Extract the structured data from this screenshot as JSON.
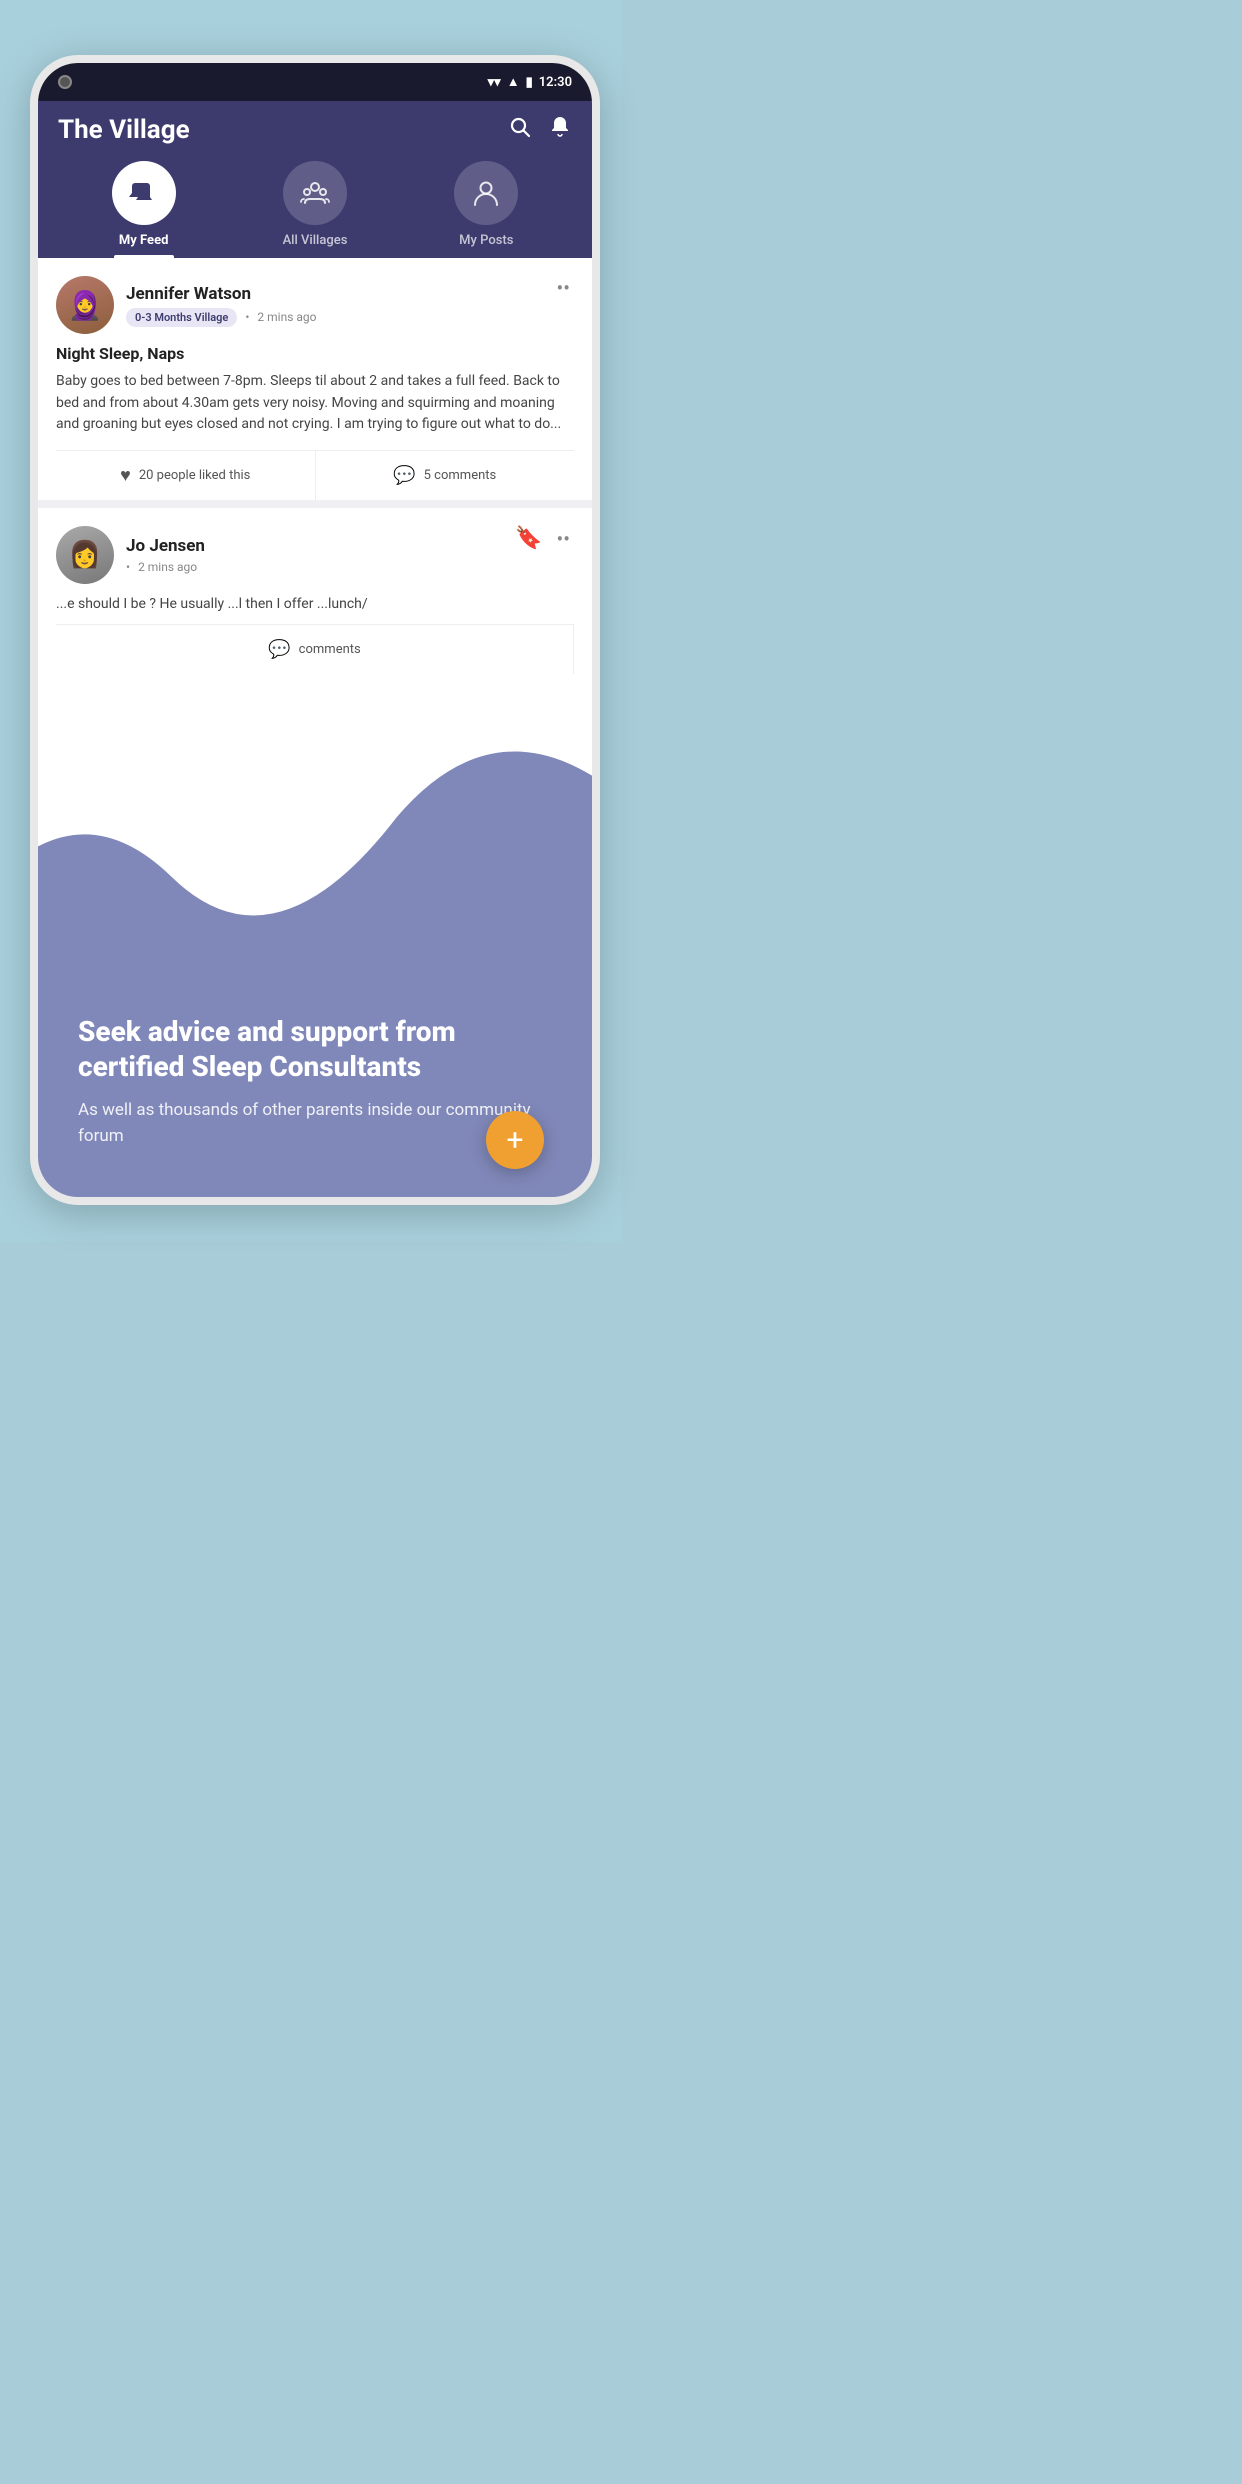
{
  "background_color": "#a8cdd9",
  "status_bar": {
    "time": "12:30",
    "icons": [
      "wifi",
      "signal",
      "battery"
    ]
  },
  "app": {
    "title": "The Village",
    "search_label": "Search",
    "notification_label": "Notifications"
  },
  "tabs": [
    {
      "id": "my-feed",
      "label": "My Feed",
      "active": true,
      "icon": "chat-bubble"
    },
    {
      "id": "all-villages",
      "label": "All Villages",
      "active": false,
      "icon": "group"
    },
    {
      "id": "my-posts",
      "label": "My Posts",
      "active": false,
      "icon": "person"
    }
  ],
  "posts": [
    {
      "id": 1,
      "author": "Jennifer Watson",
      "village_tag": "0-3 Months Village",
      "time": "2 mins ago",
      "title": "Night Sleep, Naps",
      "body": "Baby goes to bed between 7-8pm. Sleeps til about 2 and takes a full feed. Back to bed and from about 4.30am gets very noisy. Moving and squirming and moaning and groaning but eyes closed and not crying. I am trying to figure out what to do...",
      "likes_count": "20",
      "likes_label": "20 people liked this",
      "comments_count": "5",
      "comments_label": "5 comments",
      "bookmarked": false
    },
    {
      "id": 2,
      "author": "Jo Jensen",
      "village_tag": "",
      "time": "2 mins ago",
      "body": "...e should I be ? He usually ...l then I offer ...lunch/",
      "likes_count": "",
      "likes_label": "",
      "comments_count": "",
      "comments_label": "comments",
      "bookmarked": true
    }
  ],
  "marketing": {
    "headline": "Seek advice and support from certified Sleep Consultants",
    "subtext": "As well as thousands of other parents inside our community forum"
  },
  "fab": {
    "label": "+",
    "aria": "Create new post"
  }
}
